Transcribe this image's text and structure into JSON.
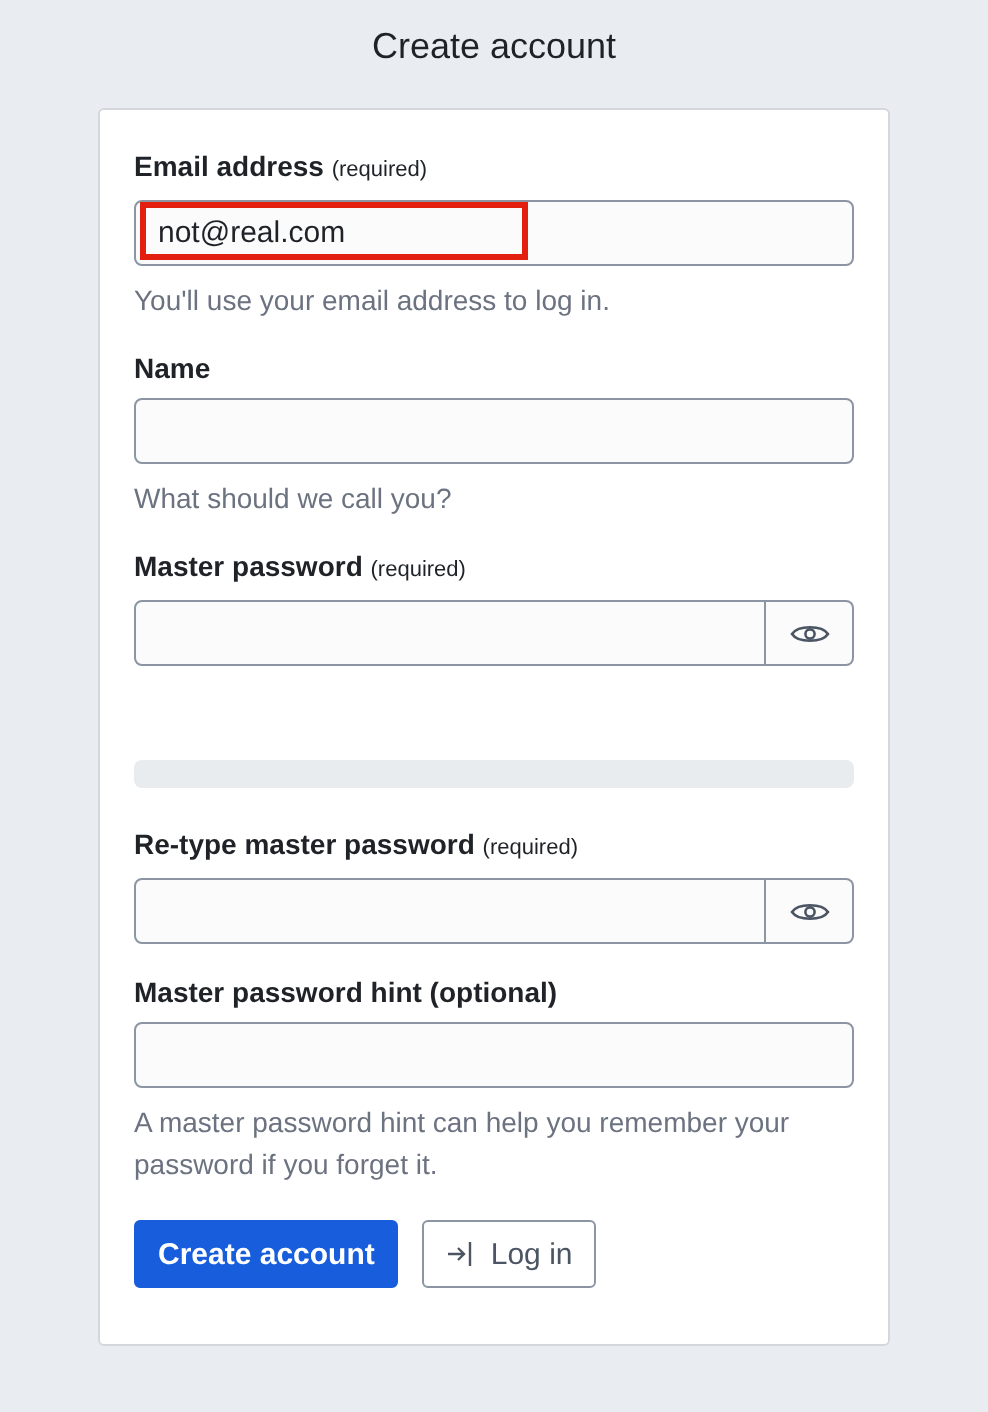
{
  "title": "Create account",
  "fields": [
    {
      "kind": "text",
      "label": "Email address",
      "note": "(required)",
      "value": "not@real.com",
      "highlighted": true,
      "help": "You'll use your email address to log in."
    },
    {
      "kind": "text",
      "label": "Name",
      "help": "What should we call you?"
    },
    {
      "kind": "password",
      "label": "Master password",
      "note": "(required)"
    },
    {
      "kind": "meter",
      "level": 0
    },
    {
      "kind": "password",
      "label": "Re-type master password",
      "note": "(required)"
    },
    {
      "kind": "text",
      "label": "Master password hint (optional)",
      "help": "A master password hint can help you remember your password if you forget it."
    }
  ],
  "buttons": [
    {
      "kind": "primary",
      "label": "Create account"
    },
    {
      "kind": "secondary",
      "label": "Log in"
    }
  ]
}
